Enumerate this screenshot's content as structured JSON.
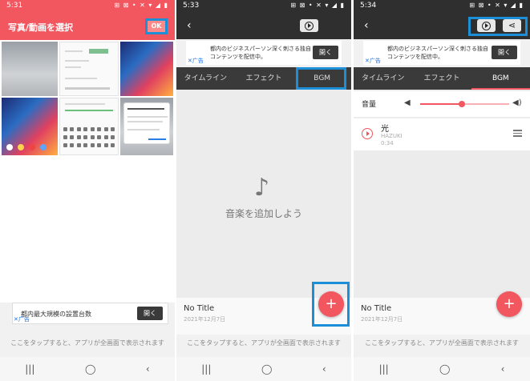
{
  "panel1": {
    "status_time": "5:31",
    "status_icons": "⊞ ⊠ •  ✕ ▾ ◢ ▮",
    "title": "写真/動画を選択",
    "ok_label": "OK",
    "ad_text": "都内最大規模の設置台数",
    "ad_button": "開く",
    "ad_mark": "✕广告",
    "bottom_message": "ここをタップすると、アプリが全画面で表示されます"
  },
  "panel2": {
    "status_time": "5:33",
    "status_icons": "⊞ ⊠ •  ✕ ▾ ◢ ▮",
    "ad_text_line1": "都内のビジネスパーソン深く刺さる独自",
    "ad_text_line2": "コンテンツを配信中。",
    "ad_button": "開く",
    "ad_mark": "✕广告",
    "tabs": [
      "タイムライン",
      "エフェクト",
      "BGM"
    ],
    "empty_text": "音楽を追加しよう",
    "project_title": "No Title",
    "project_date": "2021年12月7日",
    "fab_label": "+",
    "bottom_message": "ここをタップすると、アプリが全画面で表示されます"
  },
  "panel3": {
    "status_time": "5:34",
    "status_icons": "⊞ ⊠ •  ✕ ▾ ◢ ▮",
    "ad_text_line1": "都内のビジネスパーソン深く刺さる独自",
    "ad_text_line2": "コンテンツを配信中。",
    "ad_button": "開く",
    "ad_mark": "✕广告",
    "tabs": [
      "タイムライン",
      "エフェクト",
      "BGM"
    ],
    "volume_label": "音量",
    "volume_level": 0.47,
    "song_title": "光",
    "song_artist": "HAZUKI",
    "song_duration": "0:34",
    "project_title": "No Title",
    "project_date": "2021年12月7日",
    "fab_label": "+",
    "bottom_message": "ここをタップすると、アプリが全画面で表示されます"
  },
  "navbar": {
    "recents": "|||",
    "home": "◯",
    "back": "‹"
  },
  "colors": {
    "accent": "#f2565f",
    "highlight": "#1c8fd6",
    "dark_header": "#2f2f2f",
    "tab_bar": "#3a3a3a"
  }
}
